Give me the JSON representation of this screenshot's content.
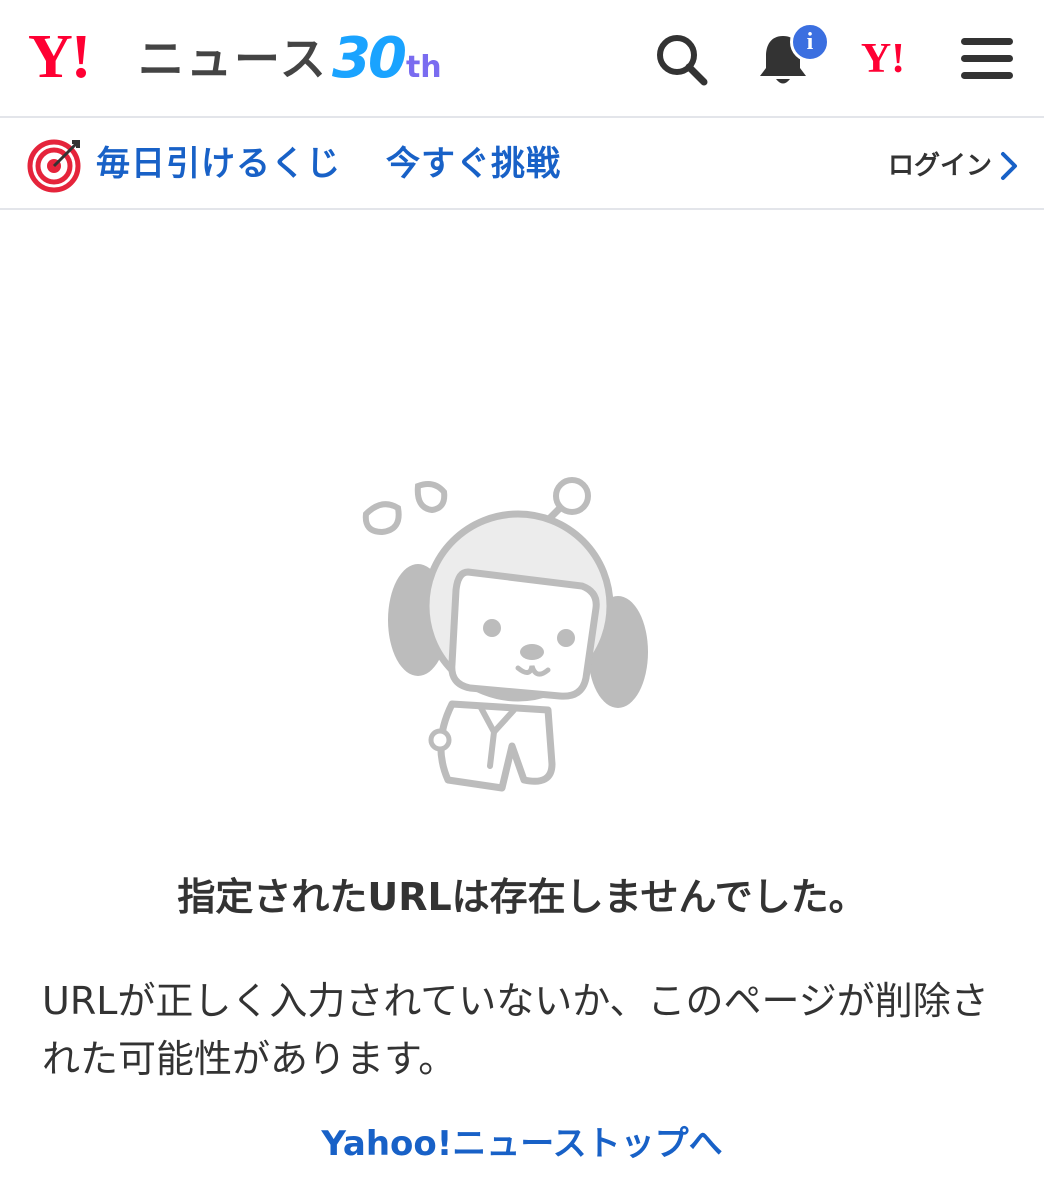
{
  "header": {
    "logo_mark": "Y!",
    "logo_text": "ニュース",
    "anniversary_number": "30",
    "anniversary_suffix": "th",
    "notification_badge": "i",
    "yahoo_japan_mark": "Y!",
    "icons": [
      "search-icon",
      "bell-icon",
      "menu-icon"
    ]
  },
  "promo": {
    "text": "毎日引けるくじ",
    "cta": "今すぐ挑戦",
    "login": "ログイン",
    "icon": "target-icon"
  },
  "error": {
    "title": "指定されたURLは存在しませんでした。",
    "description": "URLが正しく入力されていないか、このページが削除された可能性があります。",
    "link": "Yahoo!ニューストップへ"
  },
  "colors": {
    "brand_red": "#ff0033",
    "link_blue": "#1861c7",
    "badge_blue": "#3b6fe0",
    "mascot_gray": "#bcbcbc"
  }
}
